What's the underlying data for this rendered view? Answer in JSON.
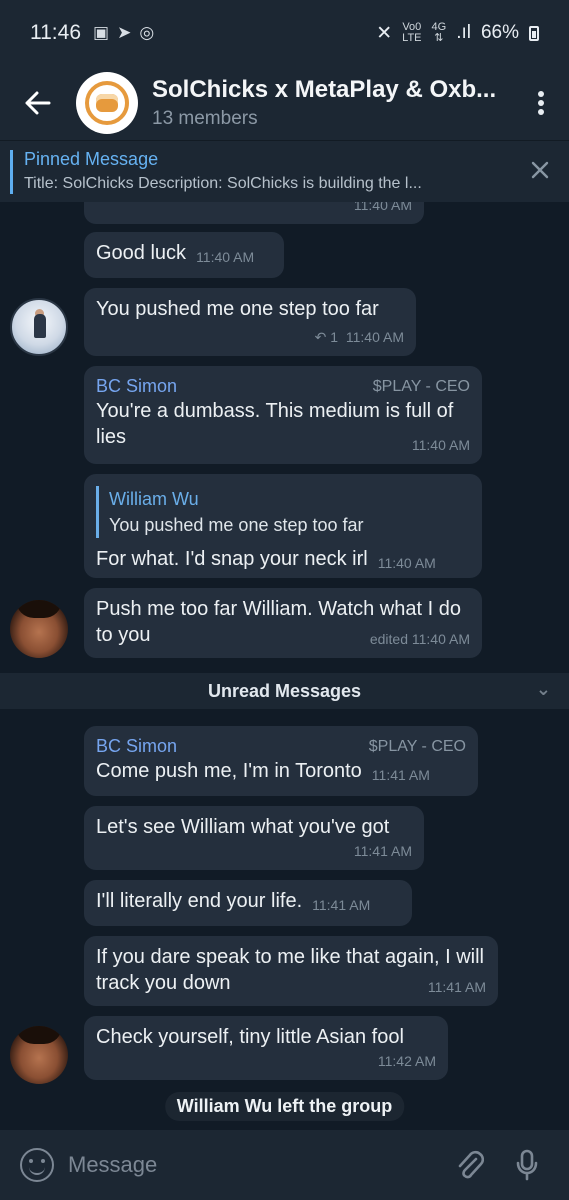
{
  "status_bar": {
    "time": "11:46",
    "network_top": "Vo0",
    "network_bottom": "LTE",
    "signal_top": "4G",
    "battery": "66%"
  },
  "header": {
    "title": "SolChicks x MetaPlay & Oxb...",
    "subtitle": "13 members"
  },
  "pinned": {
    "label": "Pinned Message",
    "text": "Title: SolChicks Description: SolChicks is building the l..."
  },
  "messages": {
    "m0": {
      "time": "11:40 AM"
    },
    "m1": {
      "text": "Good luck",
      "time": "11:40 AM"
    },
    "m2": {
      "text": "You pushed me one step too far",
      "replies": "1",
      "time": "11:40 AM"
    },
    "m3": {
      "name": "BC Simon",
      "role": "$PLAY - CEO",
      "text": "You're a dumbass. This medium is full of lies",
      "time": "11:40 AM"
    },
    "m4": {
      "quote_name": "William Wu",
      "quote_text": "You pushed me one step too far",
      "text": "For what. I'd snap your neck irl",
      "time": "11:40 AM"
    },
    "m5": {
      "text": "Push me too far William. Watch what I do to you",
      "time": "edited 11:40 AM"
    },
    "m6": {
      "name": "BC Simon",
      "role": "$PLAY - CEO",
      "text": "Come push me, I'm in Toronto",
      "time": "11:41 AM"
    },
    "m7": {
      "text": "Let's see William what you've got",
      "time": "11:41 AM"
    },
    "m8": {
      "text": "I'll literally end your life.",
      "time": "11:41 AM"
    },
    "m9": {
      "text": "If you dare speak to me like that again, I will track you down",
      "time": "11:41 AM"
    },
    "m10": {
      "text": "Check yourself, tiny little Asian fool",
      "time": "11:42 AM"
    }
  },
  "divider": {
    "label": "Unread Messages"
  },
  "service": {
    "text": "William Wu left the group"
  },
  "composer": {
    "placeholder": "Message"
  },
  "colors": {
    "background": "#111b26",
    "bar": "#1c2733",
    "bubble": "#242f3d",
    "accent": "#66b2f2",
    "name": "#76a5ef"
  }
}
